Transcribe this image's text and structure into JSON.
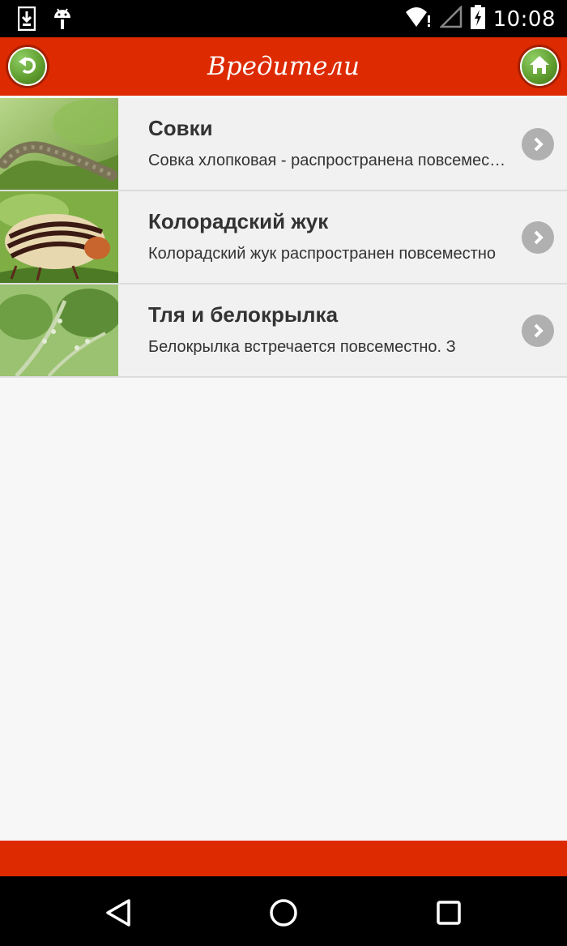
{
  "status_bar": {
    "time": "10:08",
    "icons": [
      "download-notification-icon",
      "android-debug-icon",
      "wifi-alert-icon",
      "signal-empty-icon",
      "battery-charging-icon"
    ]
  },
  "app_bar": {
    "title": "Вредители",
    "back_icon": "undo-arrow-icon",
    "home_icon": "home-icon",
    "color": "#dd2a00",
    "button_color": "#5e9c2e"
  },
  "list": {
    "items": [
      {
        "title": "Совки",
        "description": "Совка хлопковая - распространена повсеместно",
        "image": "caterpillar-on-leaf"
      },
      {
        "title": "Колорадский жук",
        "description": "Колорадский жук распространен повсеместно",
        "image": "colorado-beetle"
      },
      {
        "title": "Тля и белокрылка",
        "description": "Белокрылка встречается повсеместно. З",
        "image": "aphids-on-plant"
      }
    ]
  },
  "navigation_bar": {
    "buttons": [
      "back-triangle-icon",
      "home-circle-icon",
      "recents-square-icon"
    ]
  }
}
